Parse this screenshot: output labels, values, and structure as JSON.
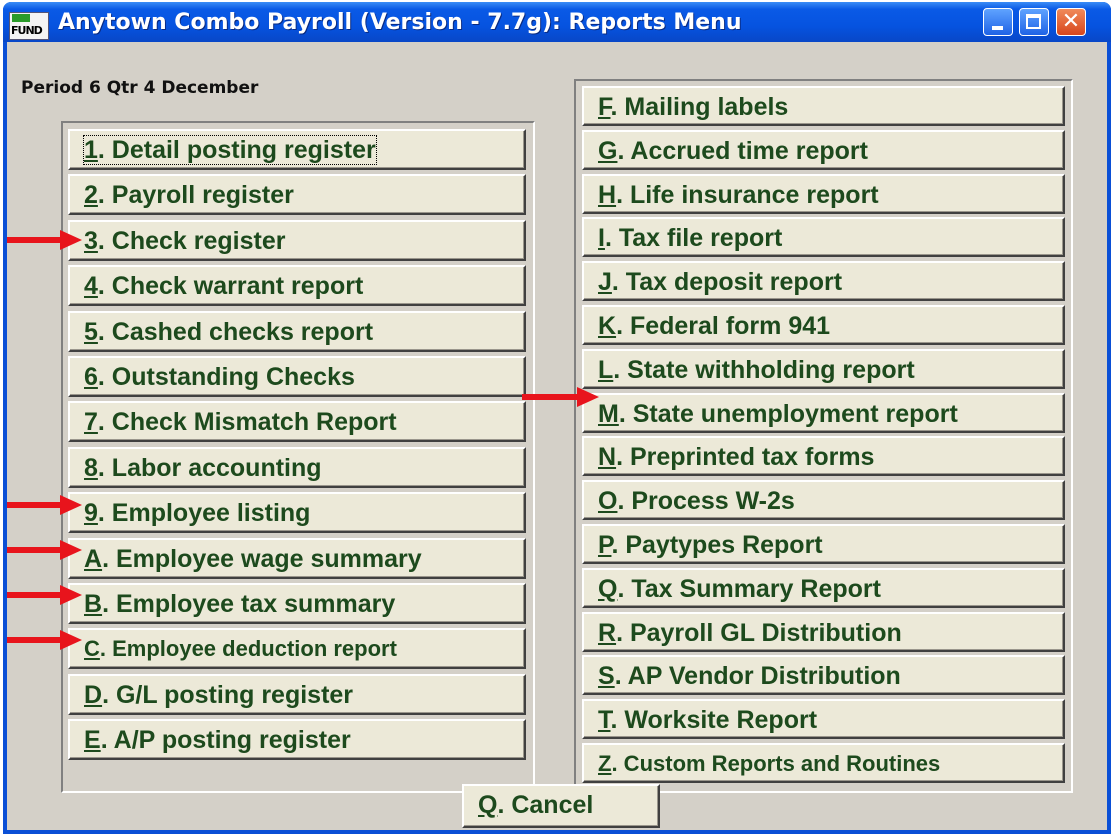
{
  "window": {
    "title": "Anytown Combo Payroll (Version - 7.7g):  Reports Menu",
    "icon_text": "FUND",
    "controls": [
      "minimize-icon",
      "maximize-icon",
      "close-icon"
    ]
  },
  "period_label": "Period 6 Qtr 4 December",
  "left_menu": [
    {
      "key": "1",
      "label": ". Detail posting register"
    },
    {
      "key": "2",
      "label": ".  Payroll register"
    },
    {
      "key": "3",
      "label": ". Check register"
    },
    {
      "key": "4",
      "label": ". Check warrant report"
    },
    {
      "key": "5",
      "label": ". Cashed checks report"
    },
    {
      "key": "6",
      "label": ". Outstanding Checks"
    },
    {
      "key": "7",
      "label": ". Check Mismatch Report"
    },
    {
      "key": "8",
      "label": ". Labor accounting"
    },
    {
      "key": "9",
      "label": ".  Employee listing"
    },
    {
      "key": "A",
      "label": ". Employee wage summary"
    },
    {
      "key": "B",
      "label": ". Employee tax summary"
    },
    {
      "key": "C",
      "label": ". Employee deduction report"
    },
    {
      "key": "D",
      "label": ". G/L posting register"
    },
    {
      "key": "E",
      "label": ". A/P posting register"
    }
  ],
  "right_menu": [
    {
      "key": "F",
      "label": ".  Mailing labels"
    },
    {
      "key": "G",
      "label": ". Accrued time report"
    },
    {
      "key": "H",
      "label": ". Life insurance report"
    },
    {
      "key": "I",
      "label": ". Tax file report"
    },
    {
      "key": "J",
      "label": ". Tax deposit report"
    },
    {
      "key": "K",
      "label": ". Federal form 941"
    },
    {
      "key": "L",
      "label": ". State withholding report"
    },
    {
      "key": "M",
      "label": ". State unemployment report"
    },
    {
      "key": "N",
      "label": ". Preprinted tax forms"
    },
    {
      "key": "O",
      "label": ". Process W-2s"
    },
    {
      "key": "P",
      "label": ".  Paytypes Report"
    },
    {
      "key": "Q",
      "label": ". Tax Summary Report"
    },
    {
      "key": "R",
      "label": ". Payroll GL Distribution"
    },
    {
      "key": "S",
      "label": ". AP Vendor Distribution"
    },
    {
      "key": "T",
      "label": ". Worksite Report"
    },
    {
      "key": "Z",
      "label": ". Custom Reports and Routines"
    }
  ],
  "cancel_button": {
    "key": "Q",
    "label": ". Cancel"
  },
  "annotation_color": "#e8141c"
}
